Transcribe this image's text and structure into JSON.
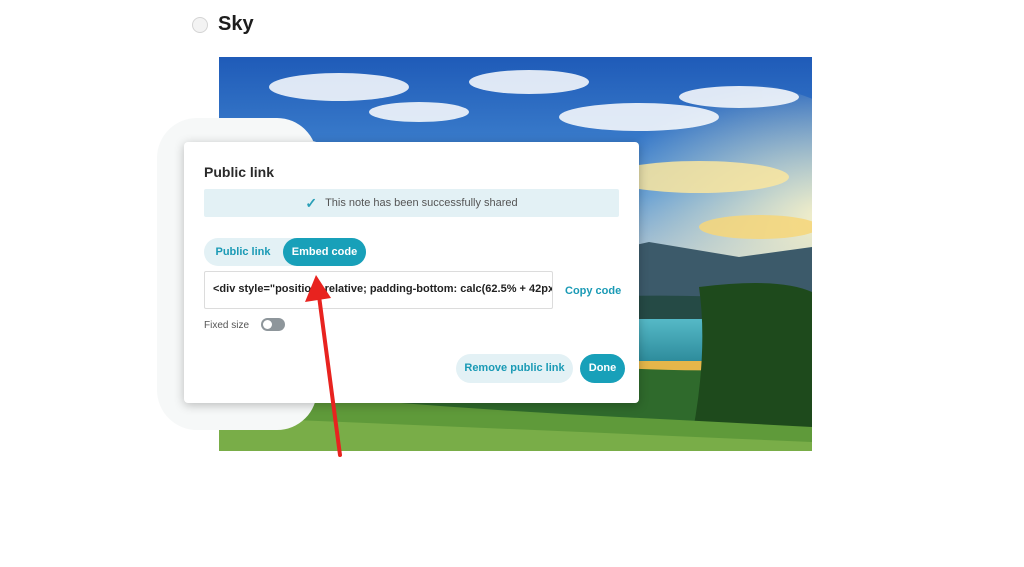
{
  "note": {
    "title": "Sky"
  },
  "dialog": {
    "title": "Public link",
    "success_message": "This note has been successfully shared",
    "tabs": [
      {
        "label": "Public link",
        "active": false
      },
      {
        "label": "Embed code",
        "active": true
      }
    ],
    "embed_code_value": "<div style=\"position: relative; padding-bottom: calc(62.5% + 42px",
    "copy_label": "Copy code",
    "fixed_size_label": "Fixed size",
    "fixed_size_on": false,
    "remove_label": "Remove public link",
    "done_label": "Done"
  },
  "colors": {
    "accent": "#18a0b9",
    "accent_light": "#e3f1f5",
    "annotation_arrow": "#e8231f"
  },
  "icons": {
    "success": "check-icon",
    "header": "radio-circle-icon"
  }
}
